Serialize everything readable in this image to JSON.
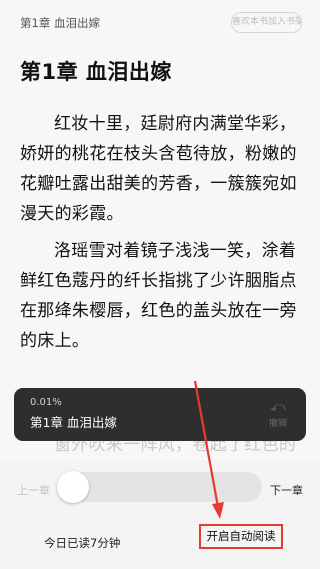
{
  "header": {
    "chapter_title": "第1章 血泪出嫁",
    "add_shelf_label": "喜欢本书加入书架"
  },
  "content": {
    "title": "第1章 血泪出嫁",
    "paragraphs": [
      "红妆十里，廷尉府内满堂华彩，娇妍的桃花在枝头含苞待放，粉嫩的花瓣吐露出甜美的芳香，一簇簇宛如漫天的彩霞。",
      "洛瑶雪对着镜子浅浅一笑，涂着鲜红色蔻丹的纤长指挑了少许胭脂点在那绛朱樱唇，红色的盖头放在一旁的床上。",
      "窗外吹来一阵风，卷起了红色的纱幔"
    ]
  },
  "progress_toast": {
    "percent": "0.01%",
    "chapter": "第1章 血泪出嫁",
    "undo_label": "撤销",
    "undo_icon": "undo-arrow-icon"
  },
  "controls": {
    "prev_chapter": "上一章",
    "next_chapter": "下一章",
    "progress_fraction": 0.0001,
    "today_read": "今日已读7分钟",
    "auto_read": "开启自动阅读"
  },
  "colors": {
    "annotation_red": "#e53a2f",
    "toast_bg": "#2e2e2e"
  }
}
